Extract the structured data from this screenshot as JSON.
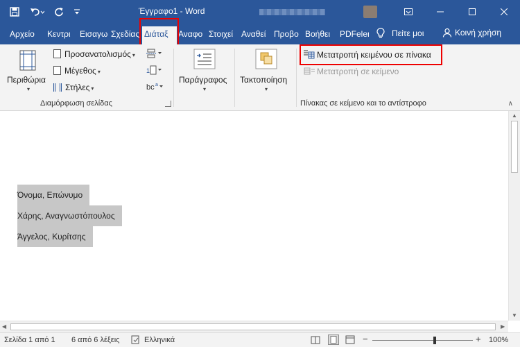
{
  "window": {
    "title": "Έγγραφο1 - Word"
  },
  "tabs": [
    "Αρχείο",
    "Κεντρι",
    "Εισαγω",
    "Σχεδίας",
    "Διάταξ",
    "Αναφο",
    "Στοιχεί",
    "Αναθεί",
    "Προβο",
    "Βοήθει",
    "PDFeler"
  ],
  "tell_me": "Πείτε μοι",
  "share": "Κοινή χρήση",
  "ribbon": {
    "margins": "Περιθώρια",
    "orientation": "Προσανατολισμός",
    "size": "Μέγεθος",
    "columns": "Στήλες",
    "page_setup_label": "Διαμόρφωση σελίδας",
    "paragraph": "Παράγραφος",
    "arrange": "Τακτοποίηση",
    "convert_to_table": "Μετατροπή κειμένου σε πίνακα",
    "convert_to_text": "Μετατροπή σε κείμενο",
    "table_text_label": "Πίνακας σε κείμενο και το αντίστροφο"
  },
  "document": {
    "lines": [
      "Όνομα, Επώνυμο",
      "Χάρης, Αναγνωστόπουλος",
      "Άγγελος, Κυρίτσης"
    ]
  },
  "status": {
    "page": "Σελίδα 1 από 1",
    "words": "6 από 6 λέξεις",
    "language": "Ελληνικά",
    "zoom": "100%"
  }
}
